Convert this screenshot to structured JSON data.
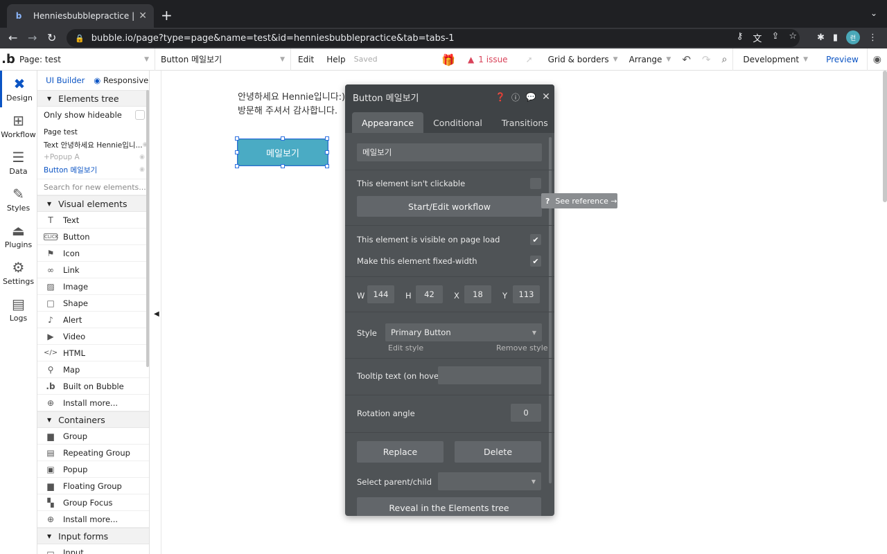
{
  "browser": {
    "tab_title": "Henniesbubblepractice | Bubble",
    "url": "bubble.io/page?type=page&name=test&id=henniesbubblepractice&tab=tabs-1",
    "profile_initial": "런"
  },
  "header": {
    "page_select": "Page: test",
    "element_select": "Button 메일보기",
    "edit": "Edit",
    "help": "Help",
    "saved": "Saved",
    "issue": "1 issue",
    "grid": "Grid & borders",
    "arrange": "Arrange",
    "env": "Development",
    "preview": "Preview"
  },
  "rail": [
    {
      "label": "Design",
      "icon": "design-icon"
    },
    {
      "label": "Workflow",
      "icon": "workflow-icon"
    },
    {
      "label": "Data",
      "icon": "data-icon"
    },
    {
      "label": "Styles",
      "icon": "brush-icon"
    },
    {
      "label": "Plugins",
      "icon": "plugin-icon"
    },
    {
      "label": "Settings",
      "icon": "gear-icon"
    },
    {
      "label": "Logs",
      "icon": "logs-icon"
    }
  ],
  "panel": {
    "tab_ui_builder": "UI Builder",
    "tab_responsive": "Responsive",
    "elements_tree": "Elements tree",
    "only_hideable": "Only show hideable",
    "tree": [
      "Page test",
      "Text 안녕하세요 Hennie입니...",
      "Popup A",
      "Button 메일보기"
    ],
    "search_placeholder": "Search for new elements...",
    "visual_elements": "Visual elements",
    "visual": [
      "Text",
      "Button",
      "Icon",
      "Link",
      "Image",
      "Shape",
      "Alert",
      "Video",
      "HTML",
      "Map",
      "Built on Bubble",
      "Install more..."
    ],
    "containers": "Containers",
    "container_items": [
      "Group",
      "Repeating Group",
      "Popup",
      "Floating Group",
      "Group Focus",
      "Install more..."
    ],
    "input_forms": "Input forms",
    "input_items": [
      "Input"
    ]
  },
  "canvas": {
    "text_line1": "안녕하세요 Hennie입니다:)",
    "text_line2": "방문해 주셔서 감사합니다.",
    "button_label": "메일보기"
  },
  "editor": {
    "title": "Button 메일보기",
    "tabs": [
      "Appearance",
      "Conditional",
      "Transitions"
    ],
    "text_value": "메일보기",
    "not_clickable": "This element isn't clickable",
    "start_workflow": "Start/Edit workflow",
    "see_reference": "See reference →",
    "visible_on_load": "This element is visible on page load",
    "fixed_width": "Make this element fixed-width",
    "w_label": "W",
    "w": "144",
    "h_label": "H",
    "h": "42",
    "x_label": "X",
    "x": "18",
    "y_label": "Y",
    "y": "113",
    "style_label": "Style",
    "style_value": "Primary Button",
    "edit_style": "Edit style",
    "remove_style": "Remove style",
    "tooltip_label": "Tooltip text (on hover)",
    "rotation_label": "Rotation angle",
    "rotation_value": "0",
    "replace": "Replace",
    "delete": "Delete",
    "parent_child": "Select parent/child",
    "reveal": "Reveal in the Elements tree"
  },
  "colors": {
    "accent": "#0b54c4",
    "button": "#4aabc4",
    "issue": "#d9435a",
    "editor_bg": "#4f5356"
  }
}
